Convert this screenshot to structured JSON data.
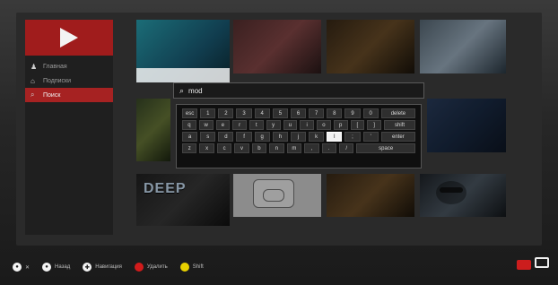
{
  "sidebar": {
    "items": [
      {
        "label": "Главная",
        "icon": "user-icon"
      },
      {
        "label": "Подписки",
        "icon": "home-icon"
      },
      {
        "label": "Поиск",
        "icon": "search-icon",
        "active": true
      }
    ]
  },
  "search": {
    "query": "mod"
  },
  "keyboard": {
    "rows": [
      [
        "esc",
        "1",
        "2",
        "3",
        "4",
        "5",
        "6",
        "7",
        "8",
        "9",
        "0",
        "delete"
      ],
      [
        "q",
        "w",
        "e",
        "r",
        "t",
        "y",
        "u",
        "i",
        "o",
        "p",
        "[",
        "]",
        "shift"
      ],
      [
        "a",
        "s",
        "d",
        "f",
        "g",
        "h",
        "j",
        "k",
        "l",
        ";",
        "'",
        "enter"
      ],
      [
        "z",
        "x",
        "c",
        "v",
        "b",
        "n",
        "m",
        ",",
        ".",
        "/",
        "space"
      ]
    ],
    "selected_key": "l"
  },
  "tiles": [
    {
      "caption": ""
    },
    {
      "caption": ""
    },
    {
      "caption": ""
    },
    {
      "caption": ""
    },
    {
      "caption": ""
    },
    {
      "caption": ""
    },
    {
      "caption": ""
    },
    {
      "caption": ""
    },
    {
      "caption": ""
    }
  ],
  "bottom_bar": {
    "hints": [
      {
        "label": "✕",
        "icon": "circle-button-icon"
      },
      {
        "label": "Назад",
        "icon": "back-button-icon"
      },
      {
        "label": "Навигация",
        "icon": "dpad-icon"
      },
      {
        "label": "Удалить",
        "icon": "red-button-icon"
      },
      {
        "label": "Shift",
        "icon": "yellow-button-icon"
      }
    ]
  }
}
